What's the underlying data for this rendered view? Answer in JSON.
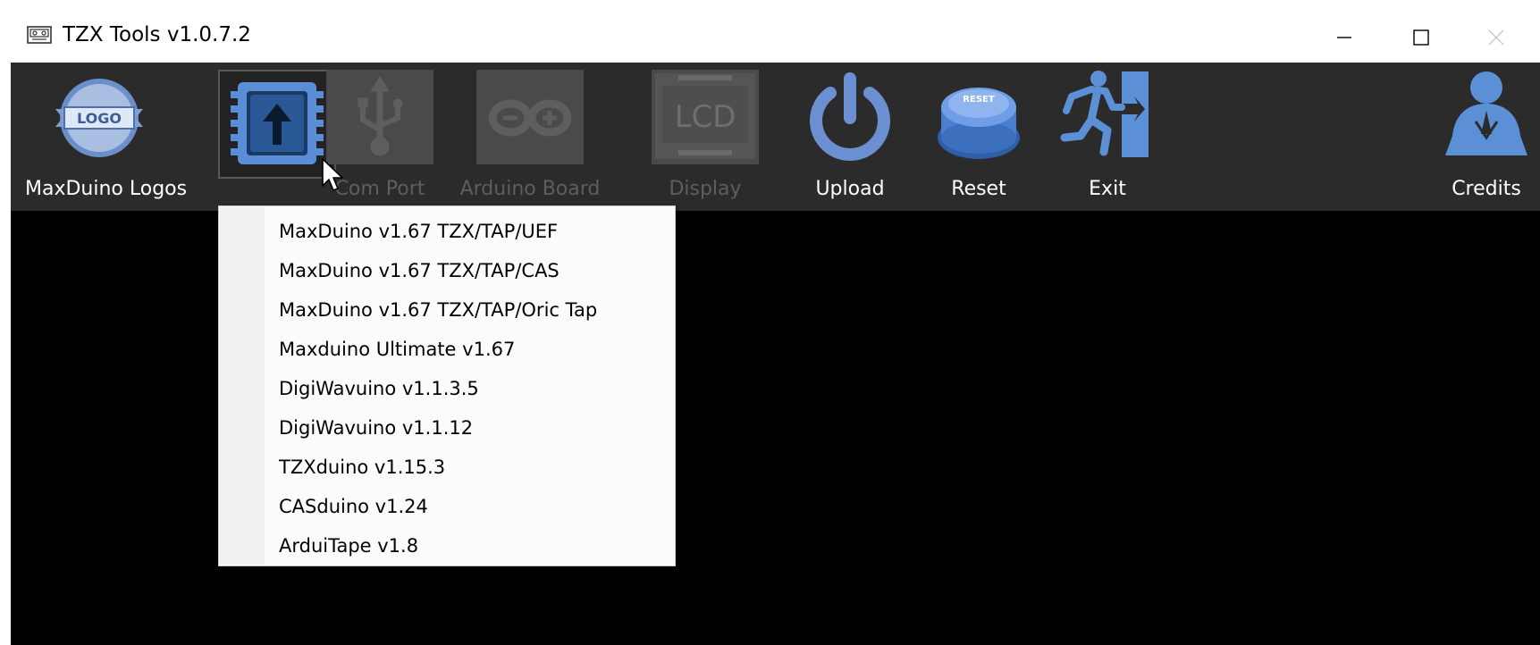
{
  "window": {
    "title": "TZX Tools v1.0.7.2",
    "app_icon": "tape-icon",
    "controls": {
      "minimize": "minimize-icon",
      "maximize": "maximize-icon",
      "close": "close-icon"
    }
  },
  "toolbar": {
    "items": [
      {
        "label": "MaxDuino Logos",
        "icon": "logo-badge-icon",
        "enabled": true
      },
      {
        "label": "",
        "icon": "upload-chip-icon",
        "enabled": true,
        "selected": true
      },
      {
        "label": "Com Port",
        "icon": "usb-icon",
        "enabled": false
      },
      {
        "label": "Arduino Board",
        "icon": "arduino-icon",
        "enabled": false
      },
      {
        "label": "Display",
        "icon": "lcd-icon",
        "enabled": false
      },
      {
        "label": "Upload",
        "icon": "power-icon",
        "enabled": true
      },
      {
        "label": "Reset",
        "icon": "reset-button-icon",
        "enabled": true
      },
      {
        "label": "Exit",
        "icon": "exit-icon",
        "enabled": true
      },
      {
        "label": "Credits",
        "icon": "credits-person-icon",
        "enabled": true
      }
    ],
    "logo_text": "LOGO",
    "lcd_text": "LCD",
    "reset_text": "RESET"
  },
  "dropdown": {
    "items": [
      "MaxDuino v1.67 TZX/TAP/UEF",
      "MaxDuino v1.67 TZX/TAP/CAS",
      "MaxDuino v1.67 TZX/TAP/Oric Tap",
      "Maxduino Ultimate v1.67",
      "DigiWavuino v1.1.3.5",
      "DigiWavuino v1.1.12",
      "TZXduino v1.15.3",
      "CASduino v1.24",
      "ArduiTape v1.8"
    ]
  },
  "colors": {
    "toolbar_bg": "#2b2b2b",
    "content_bg": "#000000",
    "accent_blue": "#5b8fd6",
    "disabled_gray": "#5e5e5e"
  }
}
